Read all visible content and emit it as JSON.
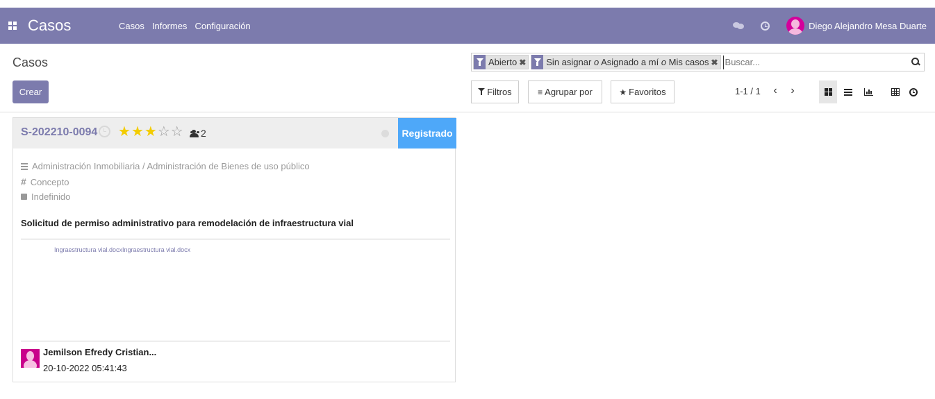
{
  "navbar": {
    "app_name": "Casos",
    "menu": [
      "Casos",
      "Informes",
      "Configuración"
    ],
    "user_name": "Diego Alejandro Mesa Duarte"
  },
  "control_panel": {
    "breadcrumb": "Casos",
    "create_label": "Crear",
    "search": {
      "facets": [
        {
          "text": "Abierto"
        },
        {
          "parts": [
            "Sin asignar",
            "o",
            "Asignado a mí",
            "o",
            "Mis casos"
          ]
        }
      ],
      "placeholder": "Buscar..."
    },
    "filters_label": "Filtros",
    "group_by_label": "Agrupar por",
    "favorites_label": "Favoritos",
    "pager": "1-1 / 1",
    "views": [
      "kanban",
      "list",
      "graph",
      "pivot",
      "activity"
    ],
    "active_view": "kanban"
  },
  "card": {
    "reference": "S-202210-0094",
    "rating": 3,
    "rating_max": 5,
    "followers": "2",
    "stage": "Registrado",
    "stage_color": "#4ea8f9",
    "category": "Administración Inmobiliaria / Administración de Bienes de uso público",
    "type": "Concepto",
    "state": "Indefinido",
    "description": "Solicitud de permiso administrativo para remodelación de infraestructura vial",
    "attachment": "Ingraestructura vial.docxIngraestructura vial.docx",
    "owner_name": "Jemilson Efredy Cristian...",
    "date": "20-10-2022 05:41:43"
  },
  "colors": {
    "navbar": "#7c7bad",
    "primary_button": "#7c7bad",
    "star_on": "#f3cc00"
  },
  "icons": {
    "apps": "apps-grid-icon",
    "chat": "chat-icon",
    "activity": "clock-icon",
    "search": "search-icon",
    "filter": "funnel-icon",
    "group": "bars-icon",
    "favorites": "star-icon",
    "prev": "chevron-left-icon",
    "next": "chevron-right-icon"
  }
}
